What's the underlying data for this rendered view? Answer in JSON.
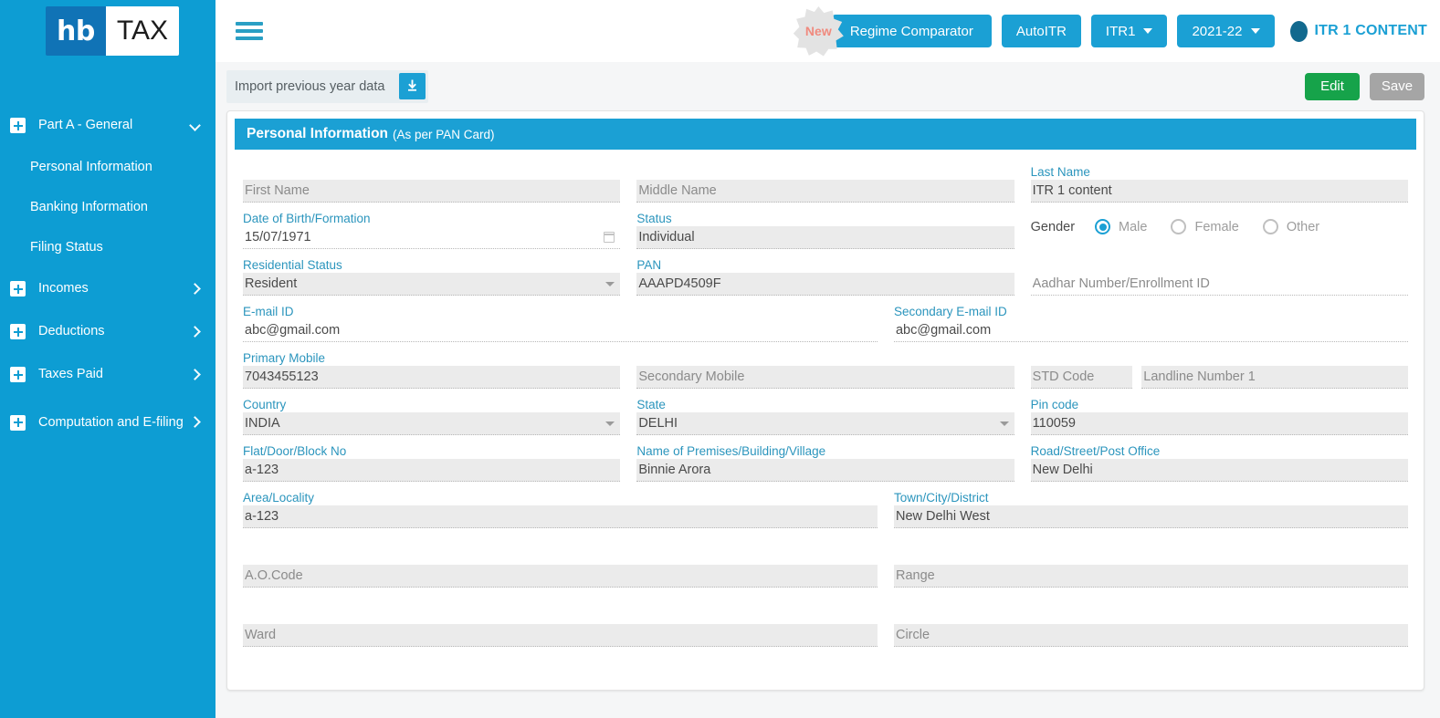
{
  "brand": {
    "logo_left": "hb",
    "logo_right": "TAX"
  },
  "topbar": {
    "new_badge": "New",
    "regime_comparator": "Regime Comparator",
    "auto_itr": "AutoITR",
    "itr_select": "ITR1",
    "year_select": "2021-22",
    "user_name": "ITR 1 CONTENT"
  },
  "toolbar": {
    "import_label": "Import previous year data",
    "edit_label": "Edit",
    "save_label": "Save"
  },
  "sidebar": {
    "groups": [
      {
        "label": "Part A - General",
        "chev": "down"
      },
      {
        "label": "Incomes",
        "chev": "right"
      },
      {
        "label": "Deductions",
        "chev": "right"
      },
      {
        "label": "Taxes Paid",
        "chev": "right"
      },
      {
        "label": "Computation and E-filing",
        "chev": "right"
      }
    ],
    "sub_items": [
      {
        "label": "Personal Information",
        "active": true
      },
      {
        "label": "Banking Information",
        "active": false
      },
      {
        "label": "Filing Status",
        "active": false
      }
    ]
  },
  "card": {
    "title": "Personal Information",
    "subtitle": "(As per PAN Card)"
  },
  "form": {
    "first_name": {
      "label": "",
      "placeholder": "First Name",
      "value": ""
    },
    "middle_name": {
      "label": "",
      "placeholder": "Middle Name",
      "value": ""
    },
    "last_name": {
      "label": "Last Name",
      "placeholder": "Last Name",
      "value": "ITR 1 content"
    },
    "dob": {
      "label": "Date of Birth/Formation",
      "placeholder": "Date of Birth/Formation",
      "value": "15/07/1971"
    },
    "status": {
      "label": "Status",
      "placeholder": "Status",
      "value": "Individual"
    },
    "gender": {
      "label": "Gender",
      "options": [
        "Male",
        "Female",
        "Other"
      ],
      "selected": "Male"
    },
    "residential_status": {
      "label": "Residential Status",
      "placeholder": "Residential Status",
      "value": "Resident"
    },
    "pan": {
      "label": "PAN",
      "placeholder": "PAN",
      "value": "AAAPD4509F"
    },
    "aadhar": {
      "label": "",
      "placeholder": "Aadhar Number/Enrollment ID",
      "value": ""
    },
    "email": {
      "label": "E-mail ID",
      "placeholder": "E-mail ID",
      "value": "abc@gmail.com"
    },
    "secondary_email": {
      "label": "Secondary E-mail ID",
      "placeholder": "Secondary E-mail ID",
      "value": "abc@gmail.com"
    },
    "primary_mobile": {
      "label": "Primary Mobile",
      "placeholder": "Primary Mobile",
      "value": "7043455123"
    },
    "secondary_mobile": {
      "label": "",
      "placeholder": "Secondary Mobile",
      "value": ""
    },
    "std_code": {
      "label": "",
      "placeholder": "STD Code",
      "value": ""
    },
    "landline": {
      "label": "",
      "placeholder": "Landline Number 1",
      "value": ""
    },
    "country": {
      "label": "Country",
      "placeholder": "Country",
      "value": "INDIA"
    },
    "state": {
      "label": "State",
      "placeholder": "State",
      "value": "DELHI"
    },
    "pin_code": {
      "label": "Pin code",
      "placeholder": "Pin code",
      "value": "110059"
    },
    "flat_no": {
      "label": "Flat/Door/Block No",
      "placeholder": "Flat/Door/Block No",
      "value": "a-123"
    },
    "premises": {
      "label": "Name of Premises/Building/Village",
      "placeholder": "Name of Premises/Building/Village",
      "value": "Binnie Arora"
    },
    "road": {
      "label": "Road/Street/Post Office",
      "placeholder": "Road/Street/Post Office",
      "value": "New Delhi"
    },
    "area": {
      "label": "Area/Locality",
      "placeholder": "Area/Locality",
      "value": "a-123"
    },
    "town": {
      "label": "Town/City/District",
      "placeholder": "Town/City/District",
      "value": "New Delhi West"
    },
    "ao_code": {
      "label": "",
      "placeholder": "A.O.Code",
      "value": ""
    },
    "range": {
      "label": "",
      "placeholder": "Range",
      "value": ""
    },
    "ward": {
      "label": "",
      "placeholder": "Ward",
      "value": ""
    },
    "circle": {
      "label": "",
      "placeholder": "Circle",
      "value": ""
    }
  },
  "colors": {
    "brand_blue": "#1ba0d4",
    "sidebar_blue": "#0d9dd3",
    "logo_dark_blue": "#1073b6",
    "edit_green": "#16a34a",
    "save_gray": "#a5a5a5",
    "label_teal": "#2b95bd",
    "field_bg": "#ebebeb",
    "badge_pink": "#f08a7e"
  }
}
